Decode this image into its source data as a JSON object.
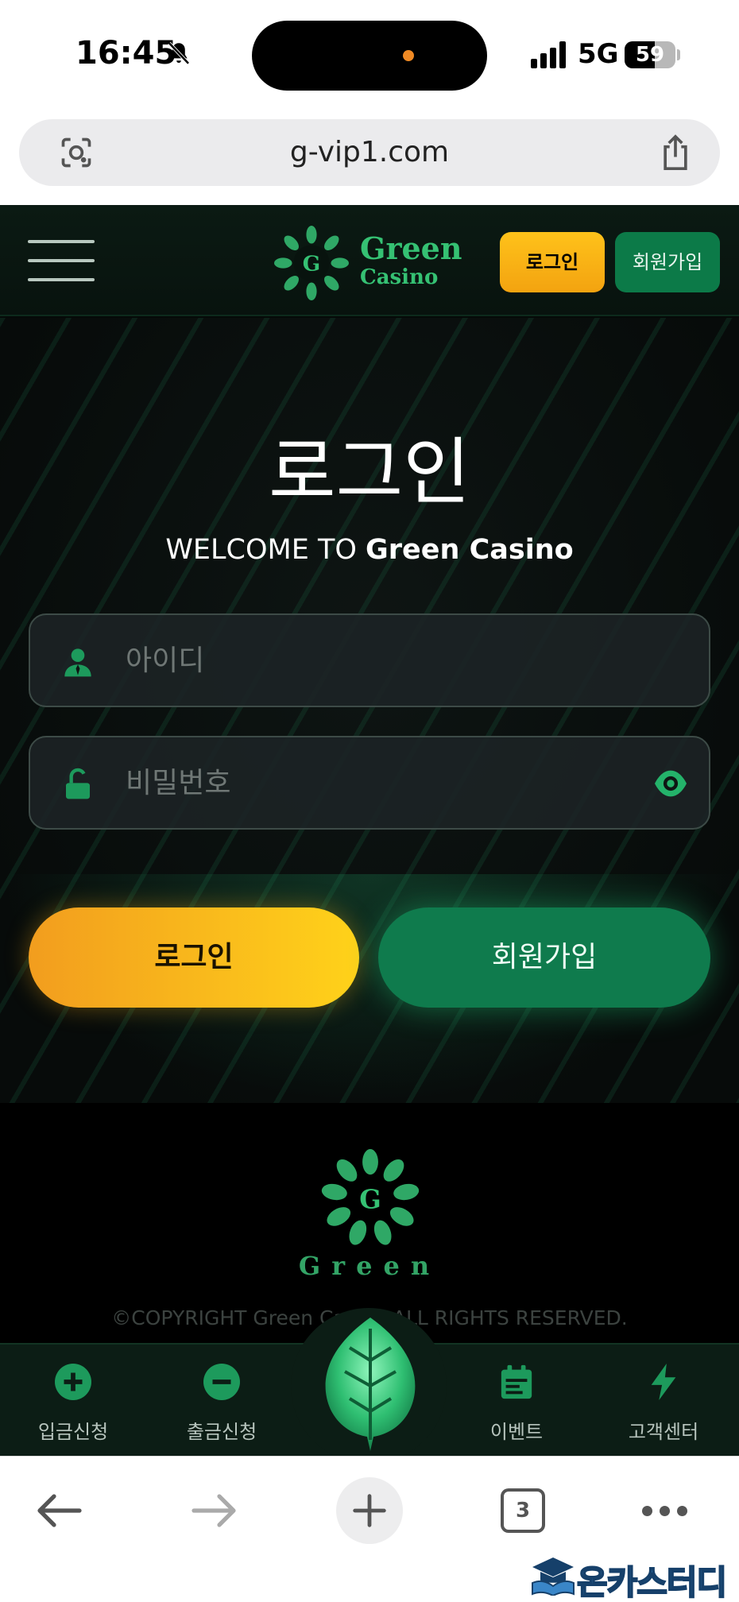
{
  "status_bar": {
    "time": "16:45",
    "network": "5G",
    "battery": "59",
    "battery_level": 0.59
  },
  "url_bar": {
    "url": "g-vip1.com"
  },
  "header": {
    "brand_line1": "Green",
    "brand_line2": "Casino",
    "login_label": "로그인",
    "join_label": "회원가입",
    "logo_letter": "G"
  },
  "login": {
    "title": "로그인",
    "welcome_prefix": "WELCOME TO ",
    "welcome_brand": "Green Casino",
    "id_placeholder": "아이디",
    "password_placeholder": "비밀번호",
    "login_button": "로그인",
    "join_button": "회원가입"
  },
  "footer": {
    "brand": "Green",
    "logo_letter": "G",
    "copyright": "©COPYRIGHT Green Casino ALL RIGHTS RESERVED."
  },
  "bottom_nav": {
    "items": [
      {
        "label": "입금신청",
        "icon": "plus-circle-icon"
      },
      {
        "label": "출금신청",
        "icon": "minus-circle-icon"
      },
      {
        "label": "",
        "icon": "leaf-icon"
      },
      {
        "label": "이벤트",
        "icon": "calendar-icon"
      },
      {
        "label": "고객센터",
        "icon": "lightning-icon"
      }
    ]
  },
  "browser_toolbar": {
    "tab_count": "3"
  },
  "watermark": {
    "text": "온카스터디"
  },
  "colors": {
    "accent_green": "#35c173",
    "accent_yellow": "#ffc21a",
    "button_green": "#0f7b4d"
  }
}
